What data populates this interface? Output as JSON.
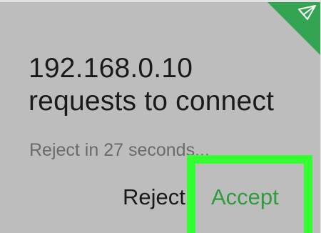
{
  "dialog": {
    "title_line1": "192.168.0.10",
    "title_line2": "requests to connect",
    "countdown": "Reject in 27 seconds...",
    "reject_label": "Reject",
    "accept_label": "Accept",
    "badge_icon": "paper-plane-icon"
  },
  "colors": {
    "background": "#bdbdbd",
    "badge": "#33a452",
    "accept_text": "#2e9b3c",
    "highlight": "#33ff33"
  }
}
